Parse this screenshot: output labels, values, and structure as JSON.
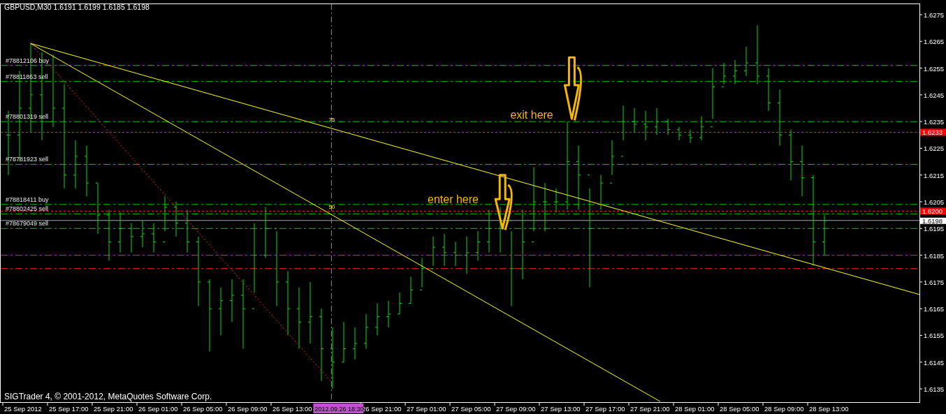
{
  "window": {
    "title": "GBPUSD,M30  1.6191 1.6199 1.6185 1.6198"
  },
  "chart": {
    "price_axis": [
      "1.6275",
      "1.6265",
      "1.6255",
      "1.6245",
      "1.6235",
      "1.6225",
      "1.6215",
      "1.6205",
      "1.6195",
      "1.6185",
      "1.6175",
      "1.6165",
      "1.6155",
      "1.6145",
      "1.6135"
    ],
    "time_axis": [
      "25 Sep 2012",
      "25 Sep 17:00",
      "25 Sep 21:00",
      "26 Sep 01:00",
      "26 Sep 05:00",
      "26 Sep 09:00",
      "26 Sep 13:00",
      "26 Sep 21:00",
      "27 Sep 01:00",
      "27 Sep 05:00",
      "27 Sep 09:00",
      "27 Sep 13:00",
      "27 Sep 17:00",
      "27 Sep 21:00",
      "28 Sep 01:00",
      "28 Sep 05:00",
      "28 Sep 09:00",
      "28 Sep 13:00"
    ],
    "crosshair_label": "2012.09.26 18:30",
    "order_lines": [
      {
        "label": "#78812106 buy"
      },
      {
        "label": "#78811863 sell"
      },
      {
        "label": "#78801319 sell"
      },
      {
        "label": "#78781923 sell"
      },
      {
        "label": "#78818411 buy"
      },
      {
        "label": "#78802425 sell"
      },
      {
        "label": "#78679049 sell"
      }
    ],
    "price_tags": [
      {
        "kind": "alert",
        "text": "1.6233"
      },
      {
        "kind": "alert",
        "text": "1.6200"
      },
      {
        "kind": "bid",
        "text": "1.6198"
      }
    ],
    "fib_labels": [
      "75",
      "50"
    ],
    "notes": [
      "exit here",
      "enter here"
    ]
  },
  "status_bar": {
    "copyright": "SIGTrader 4, © 2001-2012, MetaQuotes Software Corp."
  }
}
